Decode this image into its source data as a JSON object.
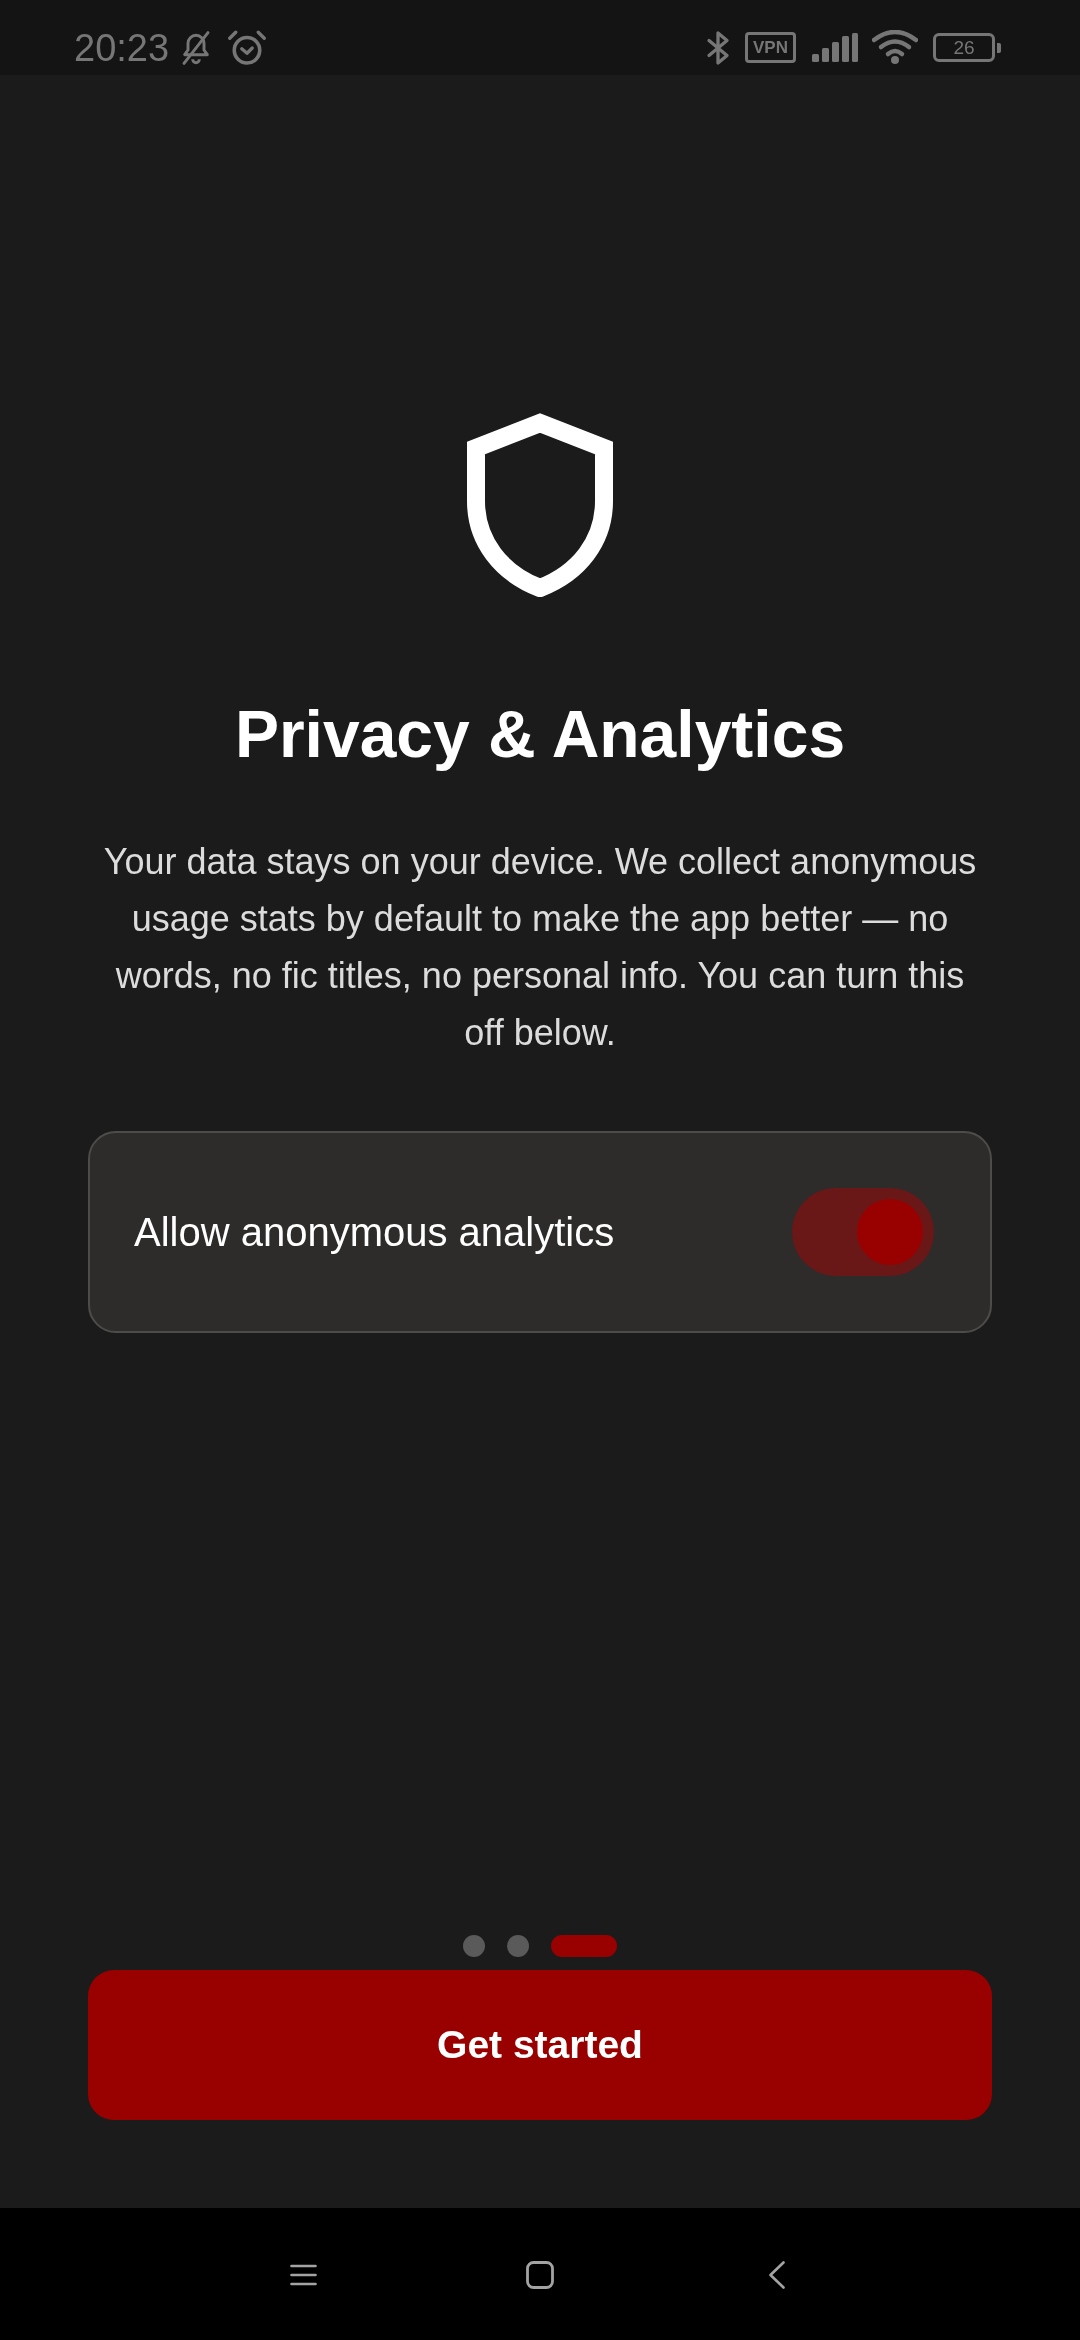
{
  "status_bar": {
    "time": "20:23",
    "vpn_label": "VPN",
    "battery": "26"
  },
  "onboarding": {
    "title": "Privacy & Analytics",
    "body": "Your data stays on your device. We collect anonymous usage stats by default to make the app better — no words, no fic titles, no personal info. You can turn this off below.",
    "setting": {
      "label": "Allow anonymous analytics",
      "on": true
    },
    "pages": [
      {
        "selected": false
      },
      {
        "selected": false
      },
      {
        "selected": true
      }
    ],
    "button": "Get started"
  }
}
